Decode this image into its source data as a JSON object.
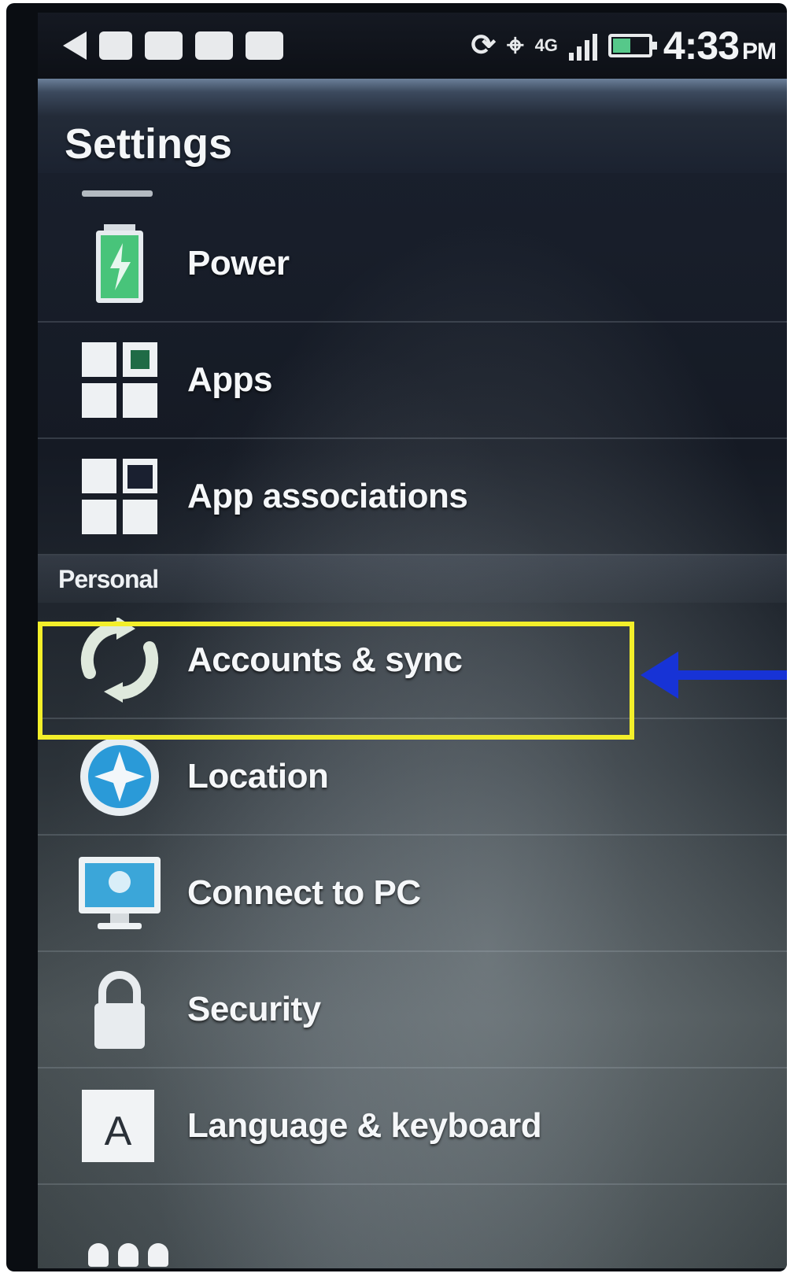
{
  "status_bar": {
    "network": "4G",
    "time": "4:33",
    "ampm": "PM",
    "battery_level": 0.5,
    "icons": [
      "back-icon",
      "alarm-icon",
      "notification-icon",
      "mail-icon",
      "message-icon",
      "sync-icon",
      "gps-icon",
      "4g-network-icon",
      "signal-icon",
      "battery-icon"
    ]
  },
  "header": {
    "title": "Settings"
  },
  "list": {
    "items_top": [
      {
        "label": "Power",
        "icon": "battery-icon"
      },
      {
        "label": "Apps",
        "icon": "apps-grid-icon"
      },
      {
        "label": "App associations",
        "icon": "app-associations-icon"
      }
    ],
    "section_personal": "Personal",
    "items_personal": [
      {
        "label": "Accounts & sync",
        "icon": "sync-icon"
      },
      {
        "label": "Location",
        "icon": "location-icon"
      },
      {
        "label": "Connect to PC",
        "icon": "connect-to-pc-icon"
      },
      {
        "label": "Security",
        "icon": "lock-icon"
      },
      {
        "label": "Language & keyboard",
        "icon": "language-keyboard-icon"
      }
    ]
  },
  "annotation": {
    "highlight_color": "#f3ef2a",
    "arrow_color": "#1733d6",
    "highlighted_item": "Accounts & sync"
  },
  "colors": {
    "screen_background": "#151a24",
    "text": "#f5f7f9"
  }
}
